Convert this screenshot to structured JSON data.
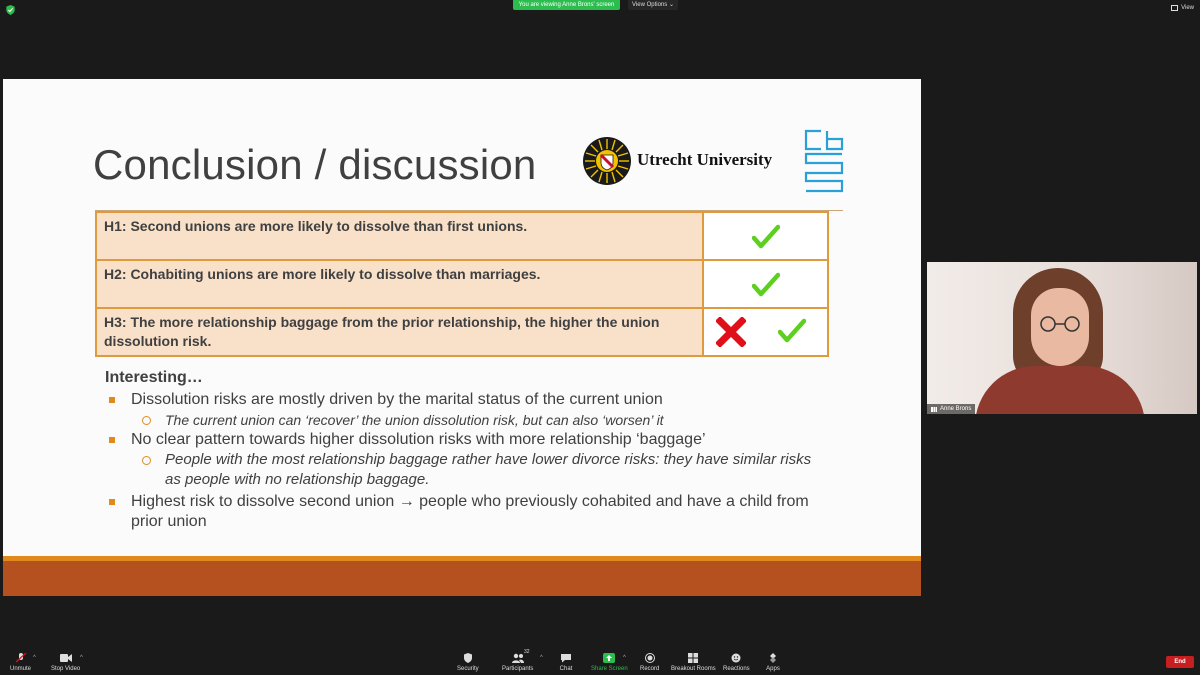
{
  "top_bar": {
    "viewing_label": "You are viewing Anne Brons' screen",
    "view_options_label": "View Options ⌄",
    "view_label": "View"
  },
  "slide": {
    "title": "Conclusion / discussion",
    "university_name": "Utrecht University",
    "hypotheses": [
      {
        "text": "H1: Second unions are more likely to dissolve than first unions.",
        "marks": [
          "check"
        ]
      },
      {
        "text": "H2: Cohabiting unions are more likely to dissolve than marriages.",
        "marks": [
          "check"
        ]
      },
      {
        "text": "H3: The more relationship baggage from the prior relationship, the higher the union dissolution risk.",
        "marks": [
          "cross",
          "check"
        ]
      }
    ],
    "interesting_heading": "Interesting…",
    "bullets": {
      "b1": "Dissolution risks are mostly driven by the marital status of the current union",
      "b1_sub": "The current union can ‘recover’ the union dissolution risk, but can also ‘worsen’ it",
      "b2": "No clear pattern towards higher dissolution risks with more relationship ‘baggage’",
      "b2_sub": "People with the most relationship baggage rather have lower divorce risks: they have similar risks as people with no relationship baggage.",
      "b3": "Highest risk to dissolve second union → people who previously cohabited and have a child from prior union"
    },
    "colors": {
      "accent_orange": "#e09a3e",
      "table_fill": "#f8e0c9",
      "footer": "#b5511e",
      "check_green": "#5ccf1f",
      "cross_red": "#e0101a"
    }
  },
  "participant": {
    "name": "Anne Brons"
  },
  "toolbar": {
    "unmute": "Unmute",
    "stop_video": "Stop Video",
    "security": "Security",
    "participants": "Participants",
    "participants_count": "32",
    "chat": "Chat",
    "share_screen": "Share Screen",
    "record": "Record",
    "breakout_rooms": "Breakout Rooms",
    "reactions": "Reactions",
    "apps": "Apps",
    "end": "End"
  }
}
